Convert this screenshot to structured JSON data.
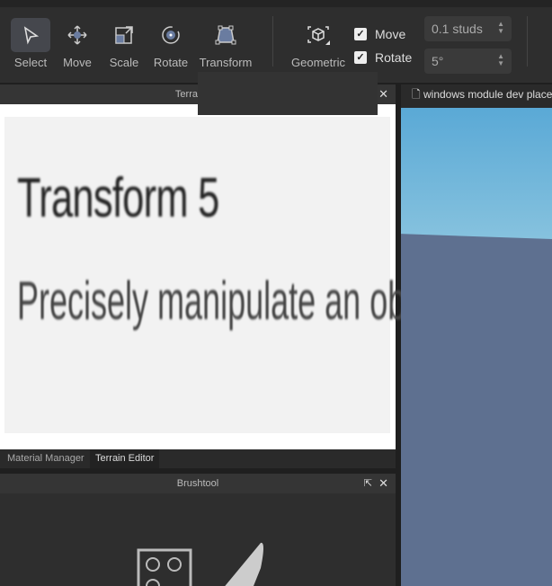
{
  "toolbar": {
    "tools": [
      {
        "label": "Select",
        "icon": "cursor-icon"
      },
      {
        "label": "Move",
        "icon": "move-icon"
      },
      {
        "label": "Scale",
        "icon": "scale-icon"
      },
      {
        "label": "Rotate",
        "icon": "rotate-icon"
      },
      {
        "label": "Transform",
        "icon": "transform-icon"
      }
    ],
    "geometric_label": "Geometric",
    "move_label": "Move",
    "move_checked": true,
    "rotate_label": "Rotate",
    "rotate_checked": true,
    "move_increment": "0.1 studs",
    "rotate_increment": "5°"
  },
  "terrain_panel": {
    "title": "Terrain Ed",
    "image_title": "Transform 5",
    "image_subtitle": "Precisely manipulate an object"
  },
  "tabs": [
    "Material Manager",
    "Terrain Editor"
  ],
  "brush_panel": {
    "title": "Brushtool"
  },
  "viewport": {
    "tab_title": "windows module dev place"
  }
}
